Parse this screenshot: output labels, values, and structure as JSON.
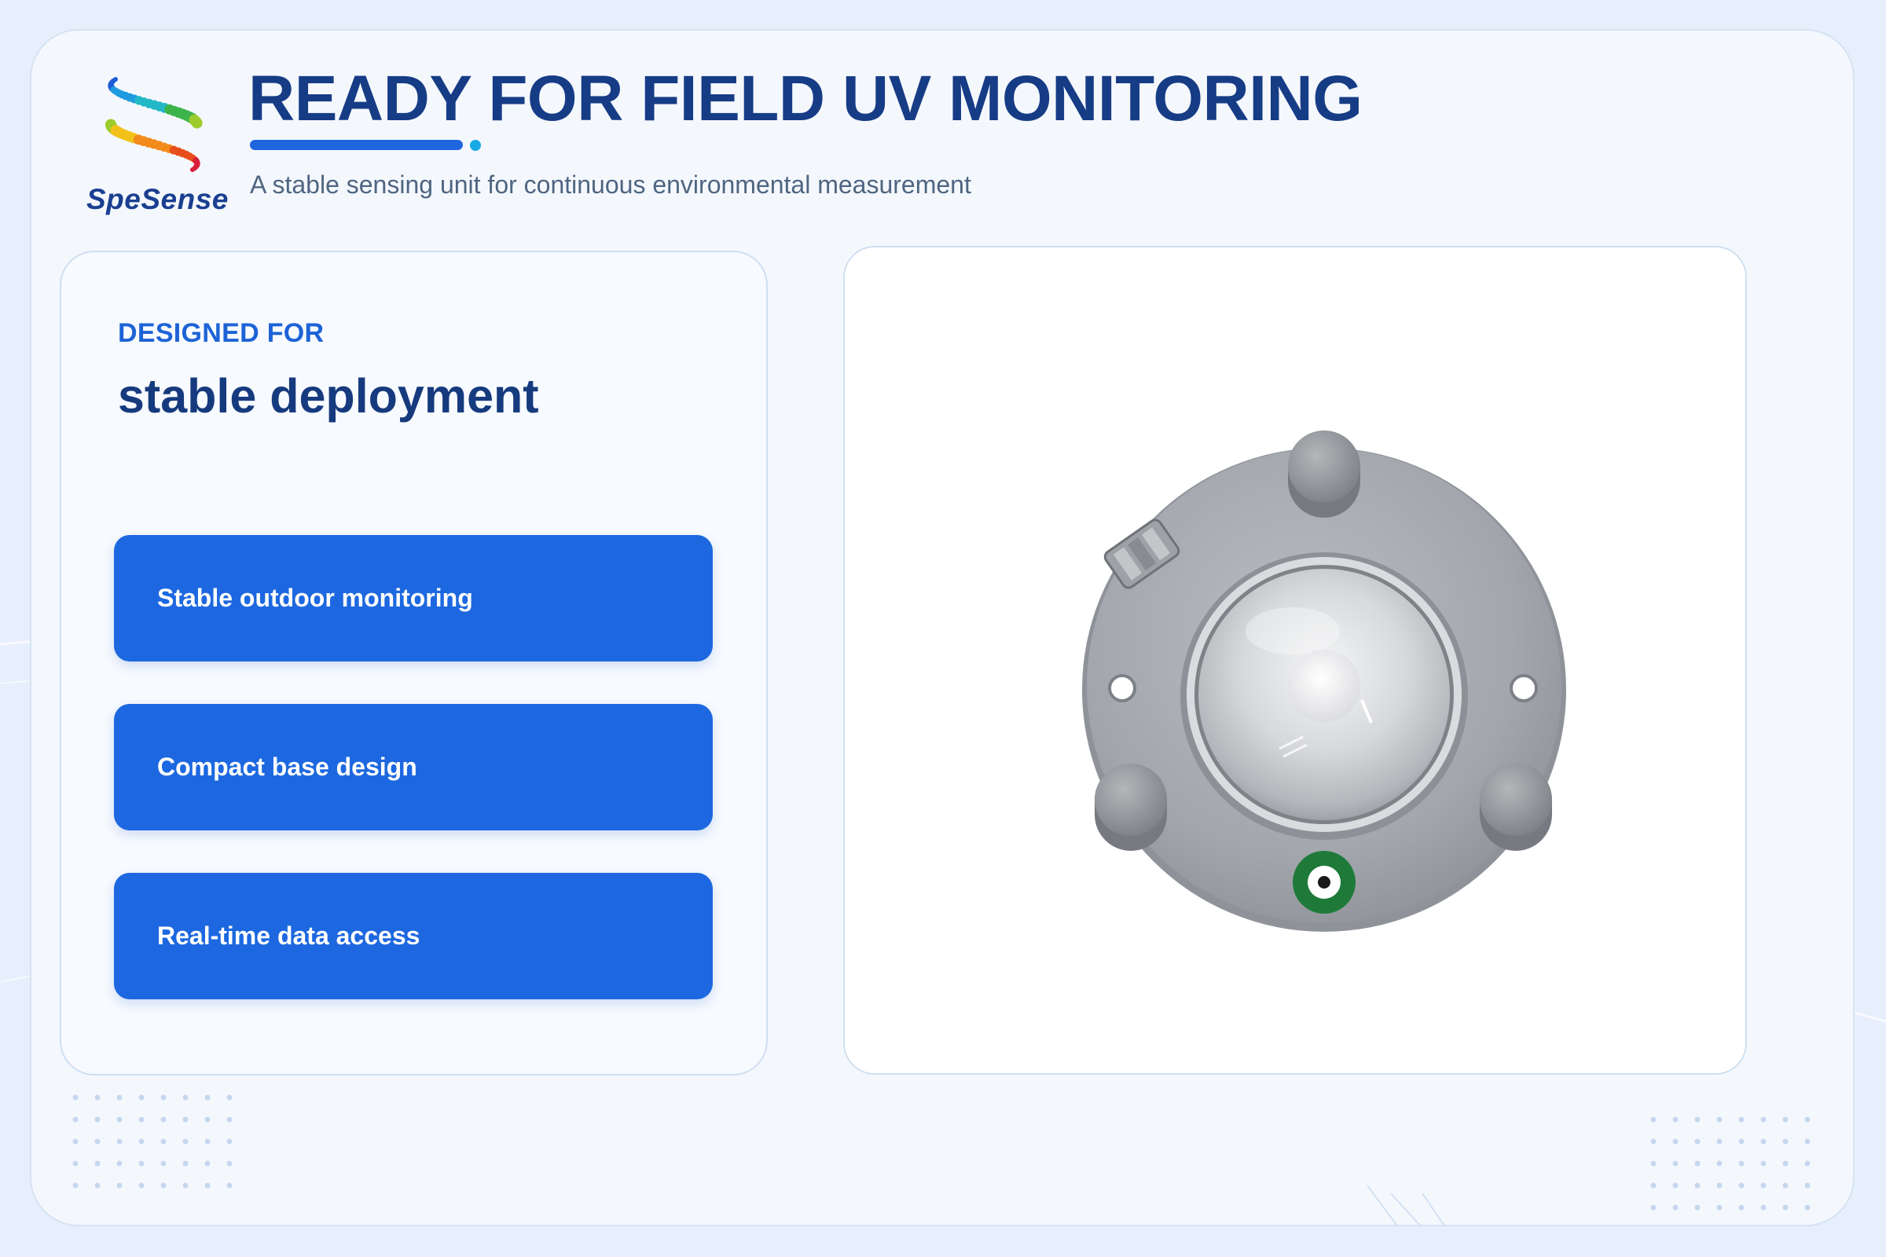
{
  "brand": {
    "name": "SpeSense"
  },
  "header": {
    "title": "READY FOR FIELD UV MONITORING",
    "subtitle": "A stable sensing unit for continuous environmental measurement"
  },
  "left_card": {
    "eyebrow": "DESIGNED FOR",
    "heading": "stable deployment",
    "features": [
      {
        "label": "Stable outdoor monitoring"
      },
      {
        "label": "Compact base design"
      },
      {
        "label": "Real-time data access"
      }
    ]
  },
  "colors": {
    "title": "#173c86",
    "accent": "#1f66de",
    "feature_bg": "#1d68e0",
    "background": "#e6effb"
  }
}
